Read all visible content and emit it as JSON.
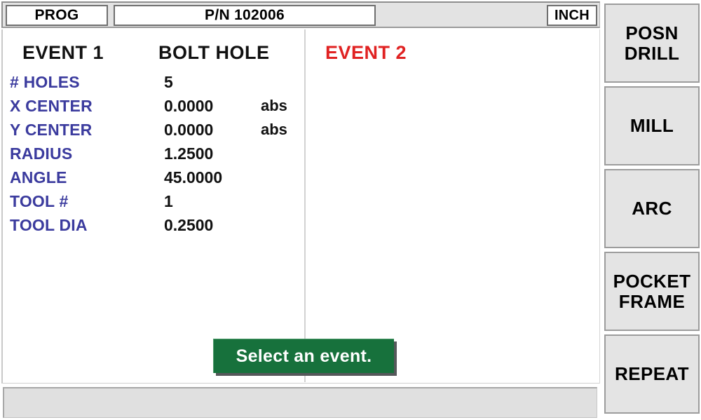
{
  "topbar": {
    "mode_label": "PROG",
    "part_number": "P/N 102006",
    "units": "INCH"
  },
  "columns": {
    "event1_header": "EVENT 1",
    "event_type": "BOLT HOLE",
    "event2_header": "EVENT 2"
  },
  "parameters": [
    {
      "label": "# HOLES",
      "value": "5",
      "suffix": ""
    },
    {
      "label": "X CENTER",
      "value": "0.0000",
      "suffix": "abs"
    },
    {
      "label": "Y CENTER",
      "value": "0.0000",
      "suffix": "abs"
    },
    {
      "label": "RADIUS",
      "value": "1.2500",
      "suffix": ""
    },
    {
      "label": "ANGLE",
      "value": "45.0000",
      "suffix": ""
    },
    {
      "label": "TOOL #",
      "value": "1",
      "suffix": ""
    },
    {
      "label": "TOOL DIA",
      "value": "0.2500",
      "suffix": ""
    }
  ],
  "message": {
    "text": "Select an event."
  },
  "statusbar": {
    "text": ""
  },
  "softkeys": [
    {
      "line1": "POSN",
      "line2": "DRILL"
    },
    {
      "line1": "MILL",
      "line2": ""
    },
    {
      "line1": "ARC",
      "line2": ""
    },
    {
      "line1": "POCKET",
      "line2": "FRAME"
    },
    {
      "line1": "REPEAT",
      "line2": ""
    }
  ],
  "colors": {
    "label_blue": "#3b3b9e",
    "event2_red": "#e02222",
    "banner_green": "#17713c",
    "panel_gray": "#e3e3e3"
  }
}
